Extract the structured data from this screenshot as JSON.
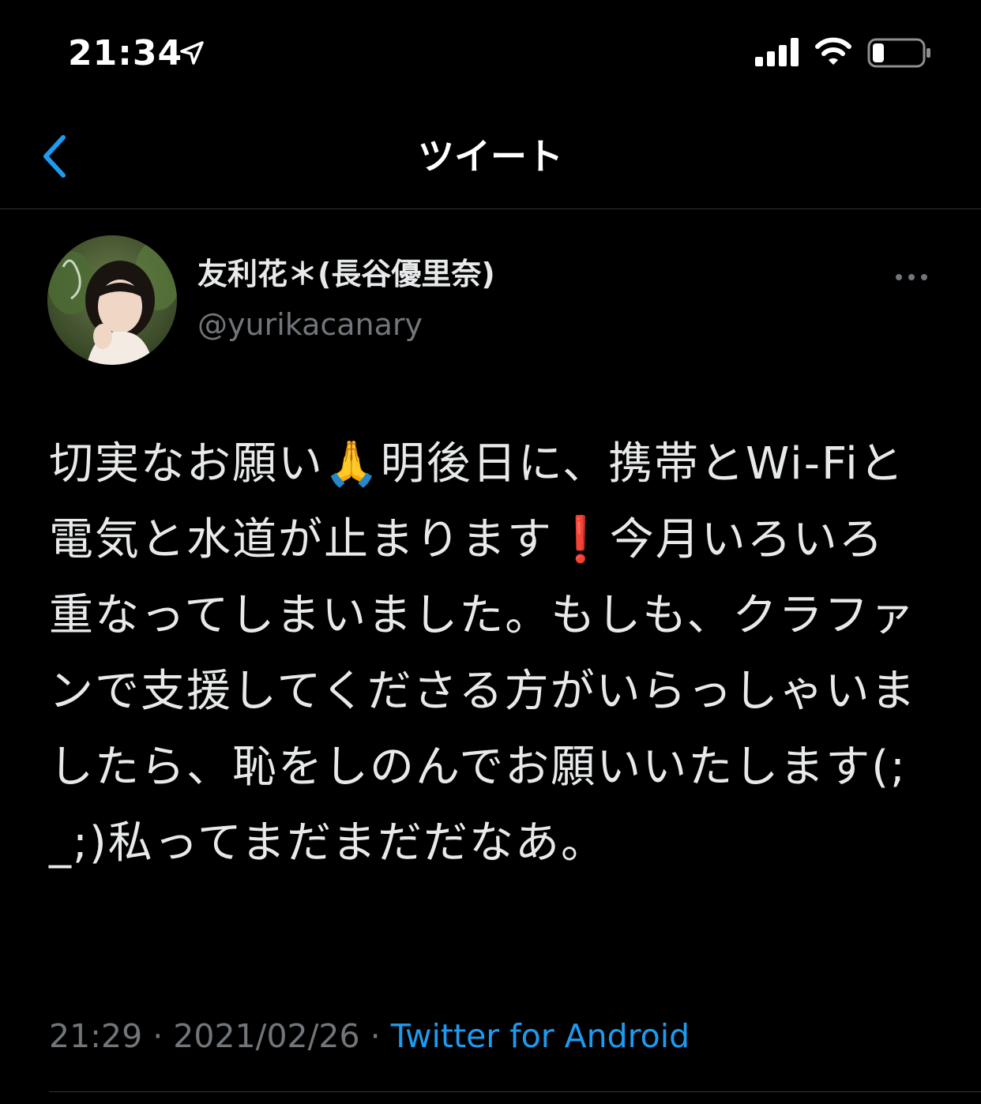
{
  "status_bar": {
    "time": "21:34",
    "icons": [
      "location-arrow-icon",
      "signal-icon",
      "wifi-icon",
      "battery-icon"
    ],
    "battery_level": 0.2
  },
  "nav": {
    "title": "ツイート",
    "back_icon": "chevron-left-icon"
  },
  "tweet": {
    "author": {
      "display_name": "友利花＊(長谷優里奈)",
      "handle": "@yurikacanary"
    },
    "text": "切実なお願い🙏明後日に、携帯とWi-Fiと電気と水道が止まります❗️今月いろいろ重なってしまいました。もしも、クラファンで支援してくださる方がいらっしゃいましたら、恥をしのんでお願いいたします(;_;)私ってまだまだだなあ。",
    "time": "21:29",
    "separator": "·",
    "date": "2021/02/26",
    "source": "Twitter for Android"
  },
  "colors": {
    "background": "#000000",
    "text_primary": "#e7e9ea",
    "text_secondary": "#71767b",
    "accent": "#1d9bf0",
    "divider": "#2f3336"
  }
}
